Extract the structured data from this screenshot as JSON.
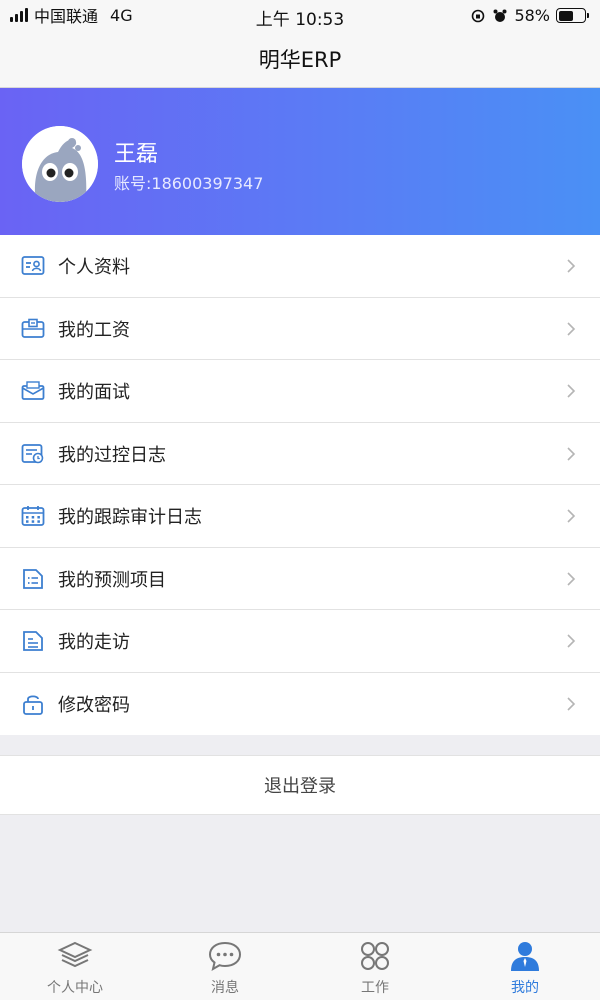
{
  "status_bar": {
    "carrier": "中国联通",
    "network": "4G",
    "time": "上午 10:53",
    "battery_percent": "58%",
    "battery_level": 0.58
  },
  "nav": {
    "title": "明华ERP"
  },
  "profile": {
    "name": "王磊",
    "account": "账号:18600397347"
  },
  "menu": [
    {
      "label": "个人资料",
      "icon": "id-card-icon"
    },
    {
      "label": "我的工资",
      "icon": "salary-icon"
    },
    {
      "label": "我的面试",
      "icon": "envelope-icon"
    },
    {
      "label": "我的过控日志",
      "icon": "log-icon"
    },
    {
      "label": "我的跟踪审计日志",
      "icon": "calendar-icon"
    },
    {
      "label": "我的预测项目",
      "icon": "list-icon"
    },
    {
      "label": "我的走访",
      "icon": "document-icon"
    },
    {
      "label": "修改密码",
      "icon": "lock-icon"
    }
  ],
  "logout": {
    "label": "退出登录"
  },
  "tabs": [
    {
      "label": "个人中心",
      "icon": "layers-icon",
      "active": false
    },
    {
      "label": "消息",
      "icon": "chat-icon",
      "active": false
    },
    {
      "label": "工作",
      "icon": "grid-icon",
      "active": false
    },
    {
      "label": "我的",
      "icon": "user-icon",
      "active": true
    }
  ],
  "colors": {
    "header_gradient_start": "#6a63f4",
    "header_gradient_end": "#4a90f5",
    "icon_blue": "#3d7fd0",
    "active_tab": "#2f7bdc"
  }
}
